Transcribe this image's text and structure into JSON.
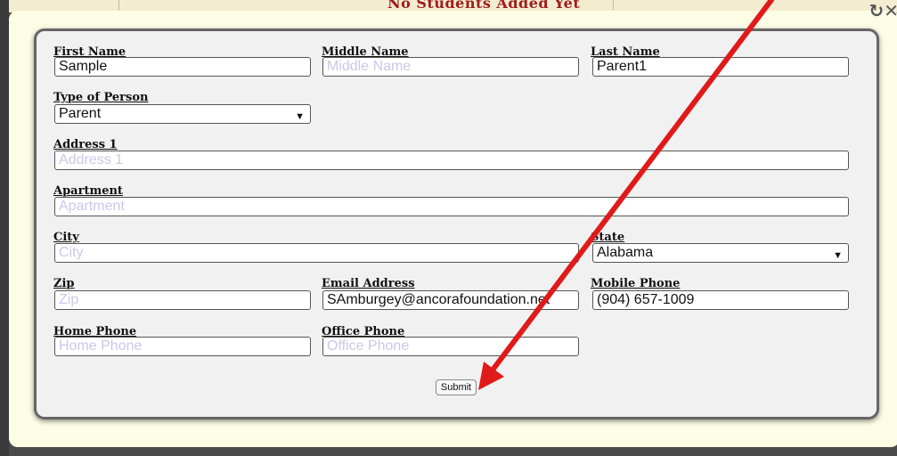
{
  "background": {
    "title": "No Students Added Yet"
  },
  "form": {
    "first_name": {
      "label": "First Name",
      "value": "Sample",
      "placeholder": ""
    },
    "middle_name": {
      "label": "Middle Name",
      "value": "",
      "placeholder": "Middle Name"
    },
    "last_name": {
      "label": "Last Name",
      "value": "Parent1",
      "placeholder": ""
    },
    "type_of_person": {
      "label": "Type of Person",
      "value": "Parent"
    },
    "address1": {
      "label": "Address 1",
      "value": "",
      "placeholder": "Address 1"
    },
    "apartment": {
      "label": "Apartment",
      "value": "",
      "placeholder": "Apartment"
    },
    "city": {
      "label": "City",
      "value": "",
      "placeholder": "City"
    },
    "state": {
      "label": "State",
      "value": "Alabama"
    },
    "zip": {
      "label": "Zip",
      "value": "",
      "placeholder": "Zip"
    },
    "email": {
      "label": "Email Address",
      "value": "SAmburgey@ancorafoundation.net"
    },
    "mobile_phone": {
      "label": "Mobile Phone",
      "value": "(904) 657-1009"
    },
    "home_phone": {
      "label": "Home Phone",
      "value": "",
      "placeholder": "Home Phone"
    },
    "office_phone": {
      "label": "Office Phone",
      "value": "",
      "placeholder": "Office Phone"
    },
    "submit_label": "Submit"
  },
  "annotation": {
    "color": "#e01a1a"
  }
}
